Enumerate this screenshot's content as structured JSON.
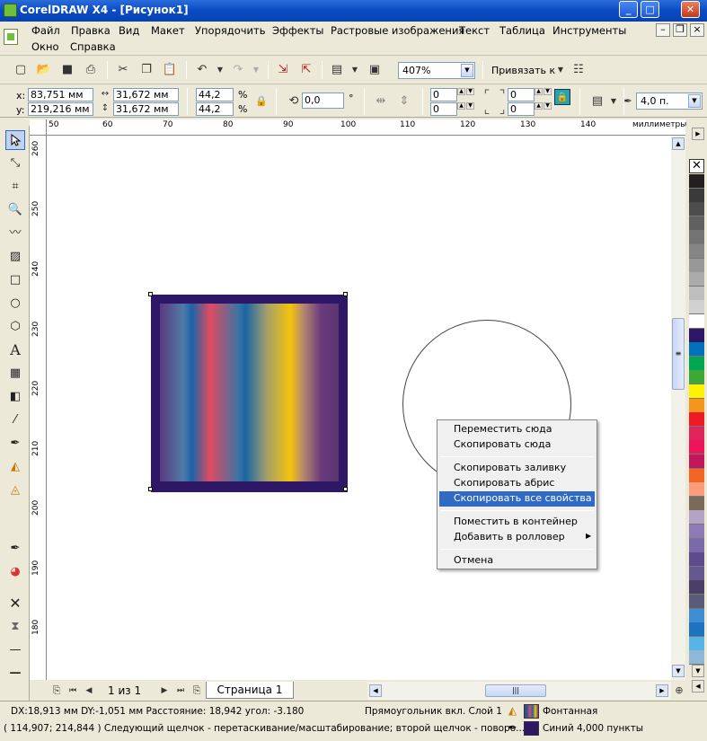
{
  "window": {
    "title": "CorelDRAW X4 - [Рисунок1]"
  },
  "menu": {
    "items": [
      "Файл",
      "Правка",
      "Вид",
      "Макет",
      "Упорядочить",
      "Эффекты",
      "Растровые изображения",
      "Текст",
      "Таблица",
      "Инструменты"
    ],
    "items_row2": [
      "Окно",
      "Справка"
    ]
  },
  "toolbar": {
    "zoom": "407%",
    "snap_label": "Привязать к"
  },
  "properties": {
    "x_label": "x:",
    "x": "83,751 мм",
    "y_label": "y:",
    "y": "219,216 мм",
    "width": "31,672 мм",
    "height": "31,672 мм",
    "scale_x": "44,2",
    "scale_y": "44,2",
    "percent": "%",
    "rotation": "0,0",
    "degree": "°",
    "corner_tl": "0",
    "corner_bl": "0",
    "corner_tr": "0",
    "corner_br": "0",
    "outline_width": "4,0 п."
  },
  "rulers": {
    "unit": "миллиметры",
    "h_ticks": [
      "50",
      "60",
      "70",
      "80",
      "90",
      "100",
      "110",
      "120",
      "130",
      "140"
    ],
    "v_ticks": [
      "260",
      "250",
      "240",
      "230",
      "220",
      "210",
      "200",
      "190",
      "180"
    ]
  },
  "context_menu": {
    "items": [
      {
        "label": "Переместить сюда"
      },
      {
        "label": "Скопировать сюда"
      },
      {
        "label": "Скопировать заливку"
      },
      {
        "label": "Скопировать абрис"
      },
      {
        "label": "Скопировать все свойства",
        "highlighted": true
      },
      {
        "label": "Поместить в контейнер"
      },
      {
        "label": "Добавить в ролловер",
        "submenu": true
      },
      {
        "label": "Отмена"
      }
    ]
  },
  "page_nav": {
    "counter": "1 из 1",
    "tab": "Страница 1"
  },
  "status": {
    "line1_left": "DX:18,913 мм DY:-1,051 мм Расстояние: 18,942 угол: -3.180",
    "line1_mid": "Прямоугольник вкл. Слой 1",
    "fill_label": "Фонтанная",
    "line2_left": "( 114,907; 214,844 )   Следующий щелчок - перетаскивание/масштабирование; второй щелчок - поворо...",
    "outline_label": "Синий  4,000 пункты"
  },
  "palette": {
    "colors": [
      "#231f20",
      "#3a3a3a",
      "#4d4d4d",
      "#606060",
      "#737373",
      "#858585",
      "#989898",
      "#ababab",
      "#bebebe",
      "#d1d1d1",
      "#ffffff",
      "#2e1866",
      "#0071bc",
      "#00a651",
      "#3aa935",
      "#fff200",
      "#f7941d",
      "#ed1c24",
      "#e0245e",
      "#ed145b",
      "#c2185b",
      "#f26522",
      "#f99d7a",
      "#7a6a5a",
      "#b5a3c7",
      "#8e7ab5",
      "#7a6aa8",
      "#5e4b8b",
      "#655790",
      "#494068",
      "#5a5a7a",
      "#3d8fd1",
      "#1e73be",
      "#57b4e6",
      "#8fb7d6"
    ],
    "fill_color": "#2e1866"
  }
}
